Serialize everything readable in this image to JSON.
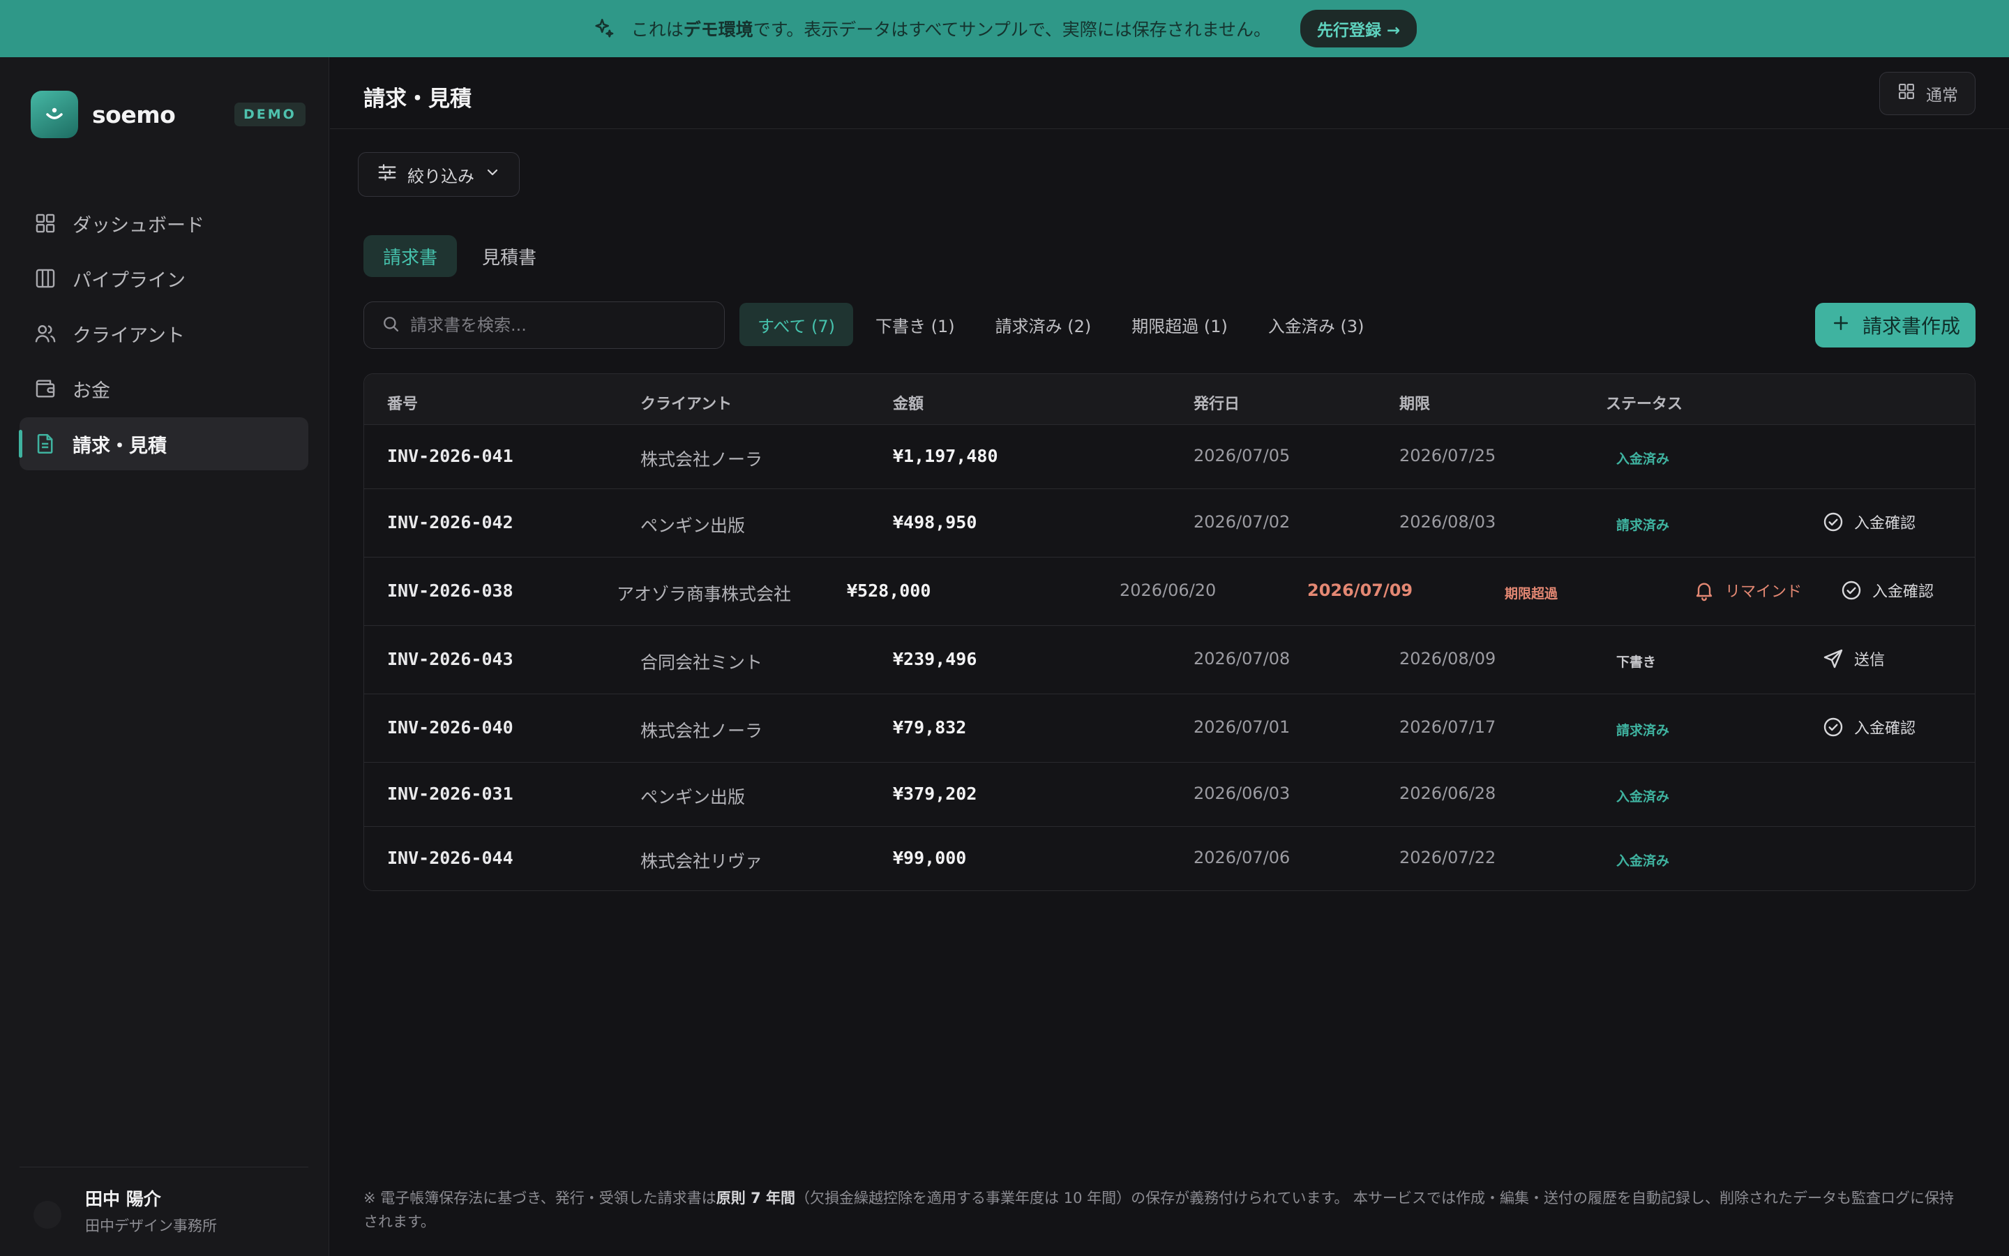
{
  "banner": {
    "text_prefix": "これは",
    "text_bold": "デモ環境",
    "text_suffix": "です。表示データはすべてサンプルで、実際には保存されません。",
    "cta_label": "先行登録 →",
    "color": "#2f9888"
  },
  "sidebar": {
    "brand": "soemo",
    "badge": "DEMO",
    "items": [
      {
        "label": "ダッシュボード",
        "icon": "grid-icon"
      },
      {
        "label": "パイプライン",
        "icon": "columns-icon"
      },
      {
        "label": "クライアント",
        "icon": "users-icon"
      },
      {
        "label": "お金",
        "icon": "wallet-icon"
      },
      {
        "label": "請求・見積",
        "icon": "document-icon",
        "active": true
      }
    ],
    "user": {
      "name": "田中 陽介",
      "org": "田中デザイン事務所"
    }
  },
  "header": {
    "title": "請求・見積",
    "view_label": "通常"
  },
  "filter": {
    "label": "絞り込み"
  },
  "doc_tabs": [
    {
      "label": "請求書",
      "active": true
    },
    {
      "label": "見積書",
      "active": false
    }
  ],
  "search": {
    "placeholder": "請求書を検索..."
  },
  "status_tabs": [
    {
      "label": "すべて (7)",
      "active": true
    },
    {
      "label": "下書き (1)"
    },
    {
      "label": "請求済み (2)"
    },
    {
      "label": "期限超過 (1)"
    },
    {
      "label": "入金済み (3)"
    }
  ],
  "create_button": {
    "label": "請求書作成"
  },
  "table": {
    "headers": [
      "番号",
      "クライアント",
      "金額",
      "発行日",
      "期限",
      "ステータス"
    ],
    "rows": [
      {
        "number": "INV-2026-041",
        "client": "株式会社ノーラ",
        "amount": "¥1,197,480",
        "issued": "2026/07/05",
        "due": "2026/07/25",
        "status": "入金済み",
        "status_color": "#3fb3a0",
        "actions": []
      },
      {
        "number": "INV-2026-042",
        "client": "ペンギン出版",
        "amount": "¥498,950",
        "issued": "2026/07/02",
        "due": "2026/08/03",
        "status": "請求済み",
        "status_color": "#3fb3a0",
        "actions": [
          {
            "label": "入金確認",
            "icon": "check-circle-icon"
          }
        ]
      },
      {
        "number": "INV-2026-038",
        "client": "アオゾラ商事株式会社",
        "amount": "¥528,000",
        "issued": "2026/06/20",
        "due": "2026/07/09",
        "status": "期限超過",
        "status_color": "#e48873",
        "overdue": true,
        "actions": [
          {
            "label": "リマインド",
            "icon": "bell-icon"
          },
          {
            "label": "入金確認",
            "icon": "check-circle-icon"
          }
        ]
      },
      {
        "number": "INV-2026-043",
        "client": "合同会社ミント",
        "amount": "¥239,496",
        "issued": "2026/07/08",
        "due": "2026/08/09",
        "status": "下書き",
        "status_color": "#c9c9cd",
        "actions": [
          {
            "label": "送信",
            "icon": "send-icon"
          }
        ]
      },
      {
        "number": "INV-2026-040",
        "client": "株式会社ノーラ",
        "amount": "¥79,832",
        "issued": "2026/07/01",
        "due": "2026/07/17",
        "status": "請求済み",
        "status_color": "#3fb3a0",
        "actions": [
          {
            "label": "入金確認",
            "icon": "check-circle-icon"
          }
        ]
      },
      {
        "number": "INV-2026-031",
        "client": "ペンギン出版",
        "amount": "¥379,202",
        "issued": "2026/06/03",
        "due": "2026/06/28",
        "status": "入金済み",
        "status_color": "#3fb3a0",
        "actions": []
      },
      {
        "number": "INV-2026-044",
        "client": "株式会社リヴァ",
        "amount": "¥99,000",
        "issued": "2026/07/06",
        "due": "2026/07/22",
        "status": "入金済み",
        "status_color": "#3fb3a0",
        "actions": []
      }
    ]
  },
  "footer_note": {
    "prefix": "※ 電子帳簿保存法に基づき、発行・受領した請求書は",
    "bold": "原則 7 年間",
    "suffix": "（欠損金繰越控除を適用する事業年度は 10 年間）の保存が義務付けられています。 本サービスでは作成・編集・送付の履歴を自動記録し、削除されたデータも監査ログに保持されます。"
  }
}
